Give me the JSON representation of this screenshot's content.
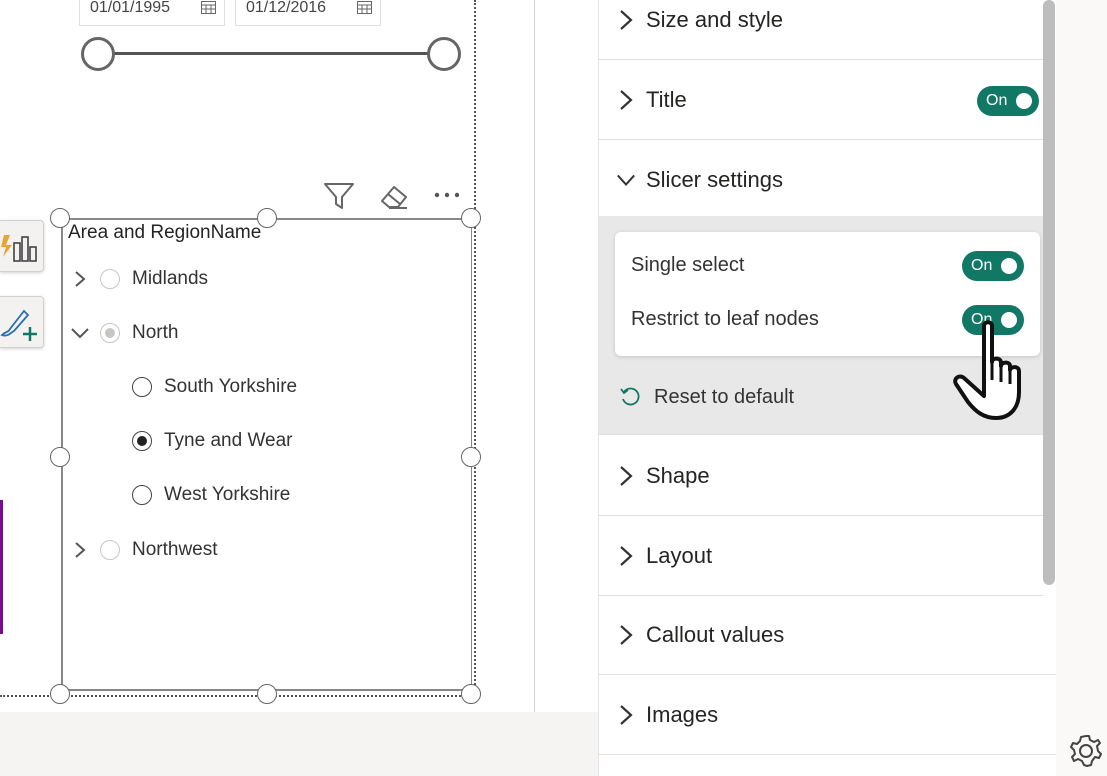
{
  "canvas": {
    "date_range": {
      "start": "01/01/1995",
      "end": "01/12/2016"
    },
    "slicer": {
      "header": "Area and RegionName",
      "items": [
        {
          "label": "Midlands",
          "level": 0,
          "expanded": false,
          "state": "none"
        },
        {
          "label": "North",
          "level": 0,
          "expanded": true,
          "state": "partial"
        },
        {
          "label": "South Yorkshire",
          "level": 1,
          "state": "unselected"
        },
        {
          "label": "Tyne and Wear",
          "level": 1,
          "state": "selected"
        },
        {
          "label": "West Yorkshire",
          "level": 1,
          "state": "unselected"
        },
        {
          "label": "Northwest",
          "level": 0,
          "expanded": false,
          "state": "none"
        }
      ]
    }
  },
  "format_pane": {
    "sections": {
      "size_style": "Size and style",
      "title": "Title",
      "slicer_settings": "Slicer settings",
      "shape": "Shape",
      "layout": "Layout",
      "callout_values": "Callout values",
      "images": "Images"
    },
    "title_toggle": "On",
    "slicer_settings": {
      "single_select_label": "Single select",
      "single_select_toggle": "On",
      "restrict_leaf_label": "Restrict to leaf nodes",
      "restrict_leaf_toggle": "On",
      "reset_label": "Reset to default"
    }
  },
  "colors": {
    "toggle_on": "#117865",
    "accent_purple": "#7a0c8f",
    "pane_highlight": "#e8e8e8"
  },
  "icons": [
    "calendar-icon",
    "filter-icon",
    "eraser-icon",
    "more-options-icon",
    "chevron-right-icon",
    "chevron-down-icon",
    "reset-icon",
    "gear-icon",
    "hand-cursor-icon"
  ]
}
